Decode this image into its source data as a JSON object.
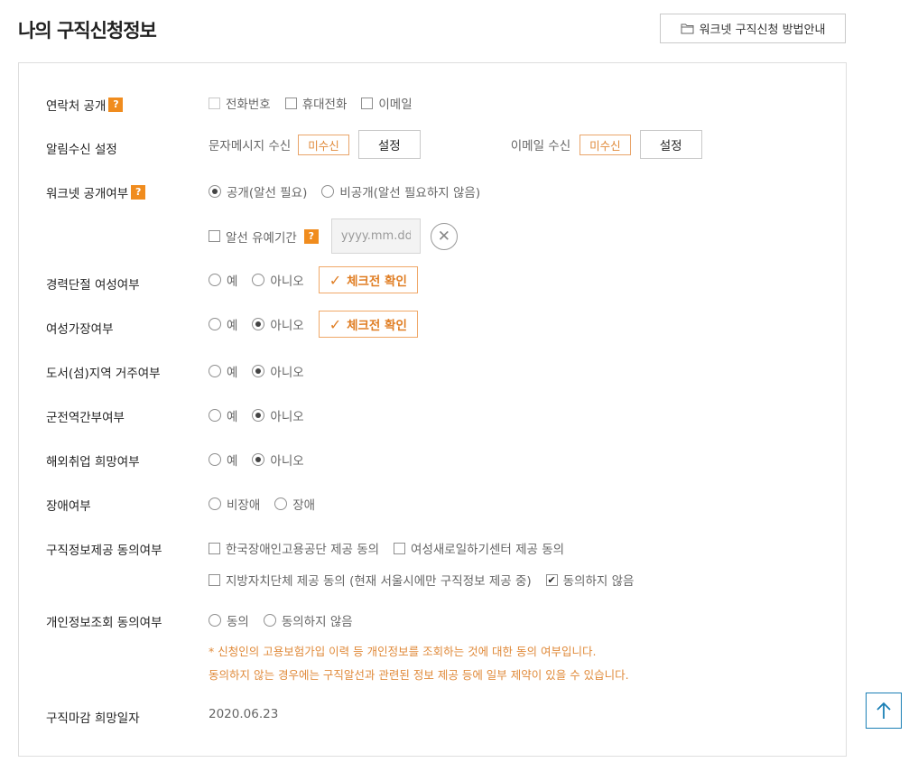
{
  "page": {
    "title": "나의 구직신청정보",
    "guide_button": "워크넷 구직신청 방법안내",
    "help_mark": "?"
  },
  "contact": {
    "label": "연락처 공개",
    "phone": "전화번호",
    "mobile": "휴대전화",
    "email": "이메일"
  },
  "notification": {
    "label": "알림수신 설정",
    "sms_label": "문자메시지 수신",
    "sms_status": "미수신",
    "sms_button": "설정",
    "email_label": "이메일 수신",
    "email_status": "미수신",
    "email_button": "설정"
  },
  "worknet_public": {
    "label": "워크넷 공개여부",
    "public": "공개(알선 필요)",
    "private": "비공개(알선 필요하지 않음)",
    "grace_label": "알선 유예기간",
    "date_placeholder": "yyyy.mm.dd"
  },
  "career_break": {
    "label": "경력단절 여성여부",
    "yes": "예",
    "no": "아니오",
    "check_button": "체크전 확인"
  },
  "female_head": {
    "label": "여성가장여부",
    "yes": "예",
    "no": "아니오",
    "check_button": "체크전 확인"
  },
  "island": {
    "label": "도서(섬)지역 거주여부",
    "yes": "예",
    "no": "아니오"
  },
  "military": {
    "label": "군전역간부여부",
    "yes": "예",
    "no": "아니오"
  },
  "overseas": {
    "label": "해외취업 희망여부",
    "yes": "예",
    "no": "아니오"
  },
  "disability": {
    "label": "장애여부",
    "non_disabled": "비장애",
    "disabled": "장애"
  },
  "job_info_consent": {
    "label": "구직정보제공 동의여부",
    "opt1": "한국장애인고용공단 제공 동의",
    "opt2": "여성새로일하기센터 제공 동의",
    "opt3": "지방자치단체 제공 동의 (현재 서울시에만 구직정보 제공 중)",
    "opt4": "동의하지 않음"
  },
  "personal_info_consent": {
    "label": "개인정보조회 동의여부",
    "agree": "동의",
    "disagree": "동의하지 않음",
    "note1": "* 신청인의 고용보험가입 이력 등 개인정보를 조회하는 것에 대한 동의 여부입니다.",
    "note2": "동의하지 않는 경우에는 구직알선과 관련된 정보 제공 등에 일부 제약이 있을 수 있습니다."
  },
  "deadline": {
    "label": "구직마감 희망일자",
    "value": "2020.06.23"
  },
  "colors": {
    "accent_orange": "#e07e24",
    "top_button_blue": "#1a7fb5"
  }
}
